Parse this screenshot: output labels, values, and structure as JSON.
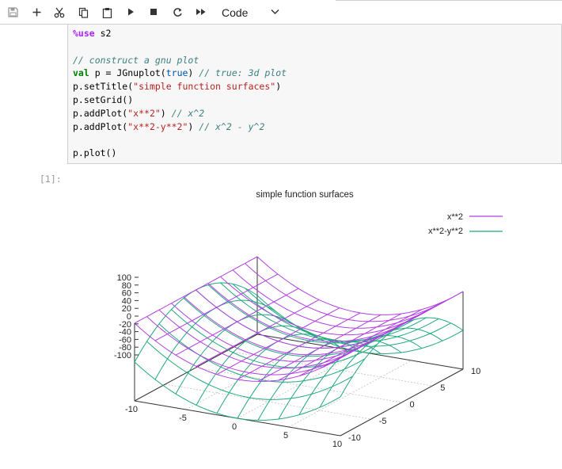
{
  "toolbar": {
    "buttons": [
      {
        "name": "save-button",
        "icon": "save-icon"
      },
      {
        "name": "insert-cell-button",
        "icon": "plus-icon"
      },
      {
        "name": "cut-button",
        "icon": "scissors-icon"
      },
      {
        "name": "copy-button",
        "icon": "copy-icon"
      },
      {
        "name": "paste-button",
        "icon": "clipboard-icon"
      },
      {
        "name": "run-button",
        "icon": "play-icon"
      },
      {
        "name": "stop-button",
        "icon": "stop-icon"
      },
      {
        "name": "restart-button",
        "icon": "restart-icon"
      },
      {
        "name": "run-all-button",
        "icon": "fast-forward-icon"
      }
    ],
    "cell_type": "Code"
  },
  "cell": {
    "code_lines": [
      [
        {
          "t": "%use",
          "c": "mg"
        },
        {
          "t": " s2",
          "c": ""
        }
      ],
      [
        {
          "t": "",
          "c": ""
        }
      ],
      [
        {
          "t": "// construct a gnu plot",
          "c": "cm"
        }
      ],
      [
        {
          "t": "val",
          "c": "kw"
        },
        {
          "t": " p = JGnuplot(",
          "c": ""
        },
        {
          "t": "true",
          "c": "bl"
        },
        {
          "t": ") ",
          "c": ""
        },
        {
          "t": "// true: 3d plot",
          "c": "cm"
        }
      ],
      [
        {
          "t": "p.setTitle(",
          "c": ""
        },
        {
          "t": "\"simple function surfaces\"",
          "c": "st"
        },
        {
          "t": ")",
          "c": ""
        }
      ],
      [
        {
          "t": "p.setGrid()",
          "c": ""
        }
      ],
      [
        {
          "t": "p.addPlot(",
          "c": ""
        },
        {
          "t": "\"x**2\"",
          "c": "st"
        },
        {
          "t": ") ",
          "c": ""
        },
        {
          "t": "// x^2",
          "c": "cm"
        }
      ],
      [
        {
          "t": "p.addPlot(",
          "c": ""
        },
        {
          "t": "\"x**2-y**2\"",
          "c": "st"
        },
        {
          "t": ") ",
          "c": ""
        },
        {
          "t": "// x^2 - y^2",
          "c": "cm"
        }
      ],
      [
        {
          "t": "",
          "c": ""
        }
      ],
      [
        {
          "t": "p.plot()",
          "c": ""
        }
      ]
    ],
    "output_prompt": "[1]:"
  },
  "colors": {
    "series1": "#b040e0",
    "series2": "#20a880",
    "axis": "#333333",
    "grid": "#c0c0c0"
  },
  "chart_data": {
    "type": "surface3d",
    "title": "simple function surfaces",
    "xlim": [
      -10,
      10
    ],
    "ylim": [
      -10,
      10
    ],
    "zlim": [
      -100,
      100
    ],
    "z_ticks": [
      100,
      80,
      60,
      40,
      20,
      0,
      -20,
      -40,
      -60,
      -80,
      -100
    ],
    "x_ticks": [
      -10,
      -5,
      0,
      5,
      10
    ],
    "y_ticks": [
      -10,
      -5,
      0,
      5,
      10
    ],
    "grid": true,
    "legend_position": "top-right",
    "series": [
      {
        "name": "x**2",
        "expression": "x**2"
      },
      {
        "name": "x**2-y**2",
        "expression": "x**2-y**2"
      }
    ]
  }
}
